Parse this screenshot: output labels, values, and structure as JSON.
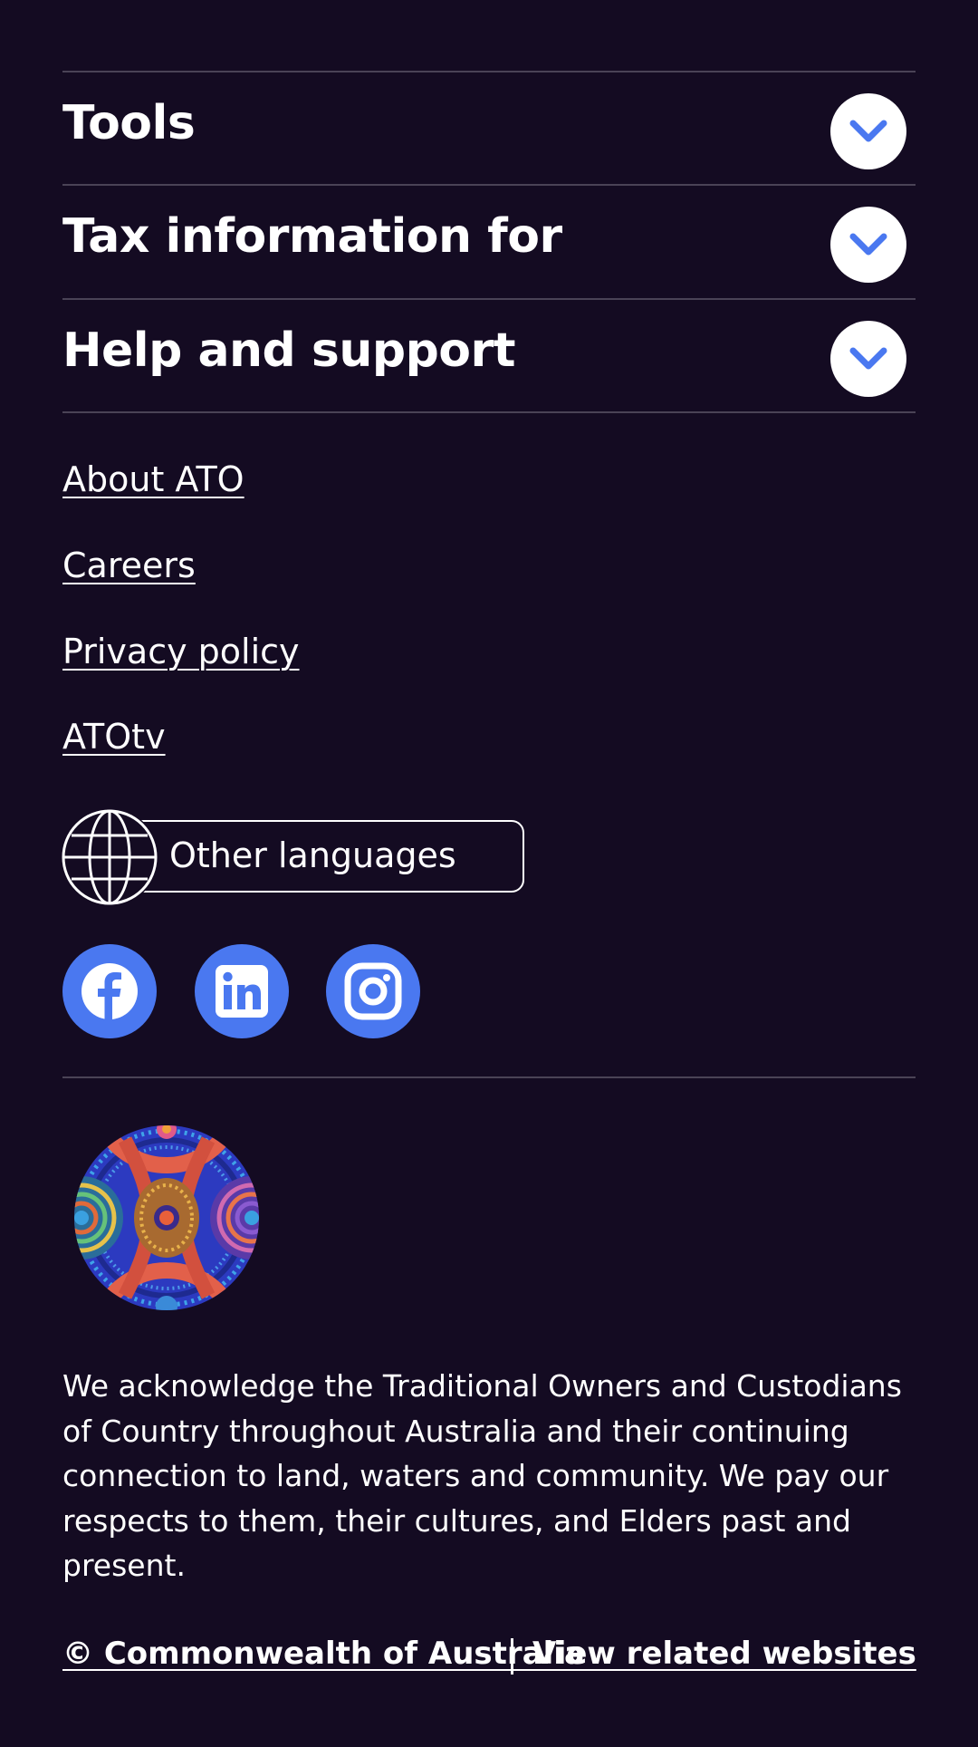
{
  "accordion": [
    {
      "title": "Tools"
    },
    {
      "title": "Tax information for"
    },
    {
      "title": "Help and support"
    }
  ],
  "links": {
    "about": "About ATO",
    "careers": "Careers",
    "privacy": "Privacy policy",
    "atotv": "ATOtv"
  },
  "language": {
    "label": "Other languages",
    "icon": "globe-icon"
  },
  "social": [
    {
      "name": "Facebook",
      "icon": "facebook-icon"
    },
    {
      "name": "LinkedIn",
      "icon": "linkedin-icon"
    },
    {
      "name": "Instagram",
      "icon": "instagram-icon"
    }
  ],
  "acknowledgement": "We acknowledge the Traditional Owners and Custodians of Country throughout Australia and their continuing connection to land, waters and community. We pay our respects to them, their cultures, and Elders past and present.",
  "footer": {
    "copyright": "© Commonwealth of Australia",
    "related": "View related websites"
  },
  "colors": {
    "background": "#140b22",
    "accent": "#4a78f0",
    "divider": "#4a4356",
    "text": "#ffffff"
  }
}
